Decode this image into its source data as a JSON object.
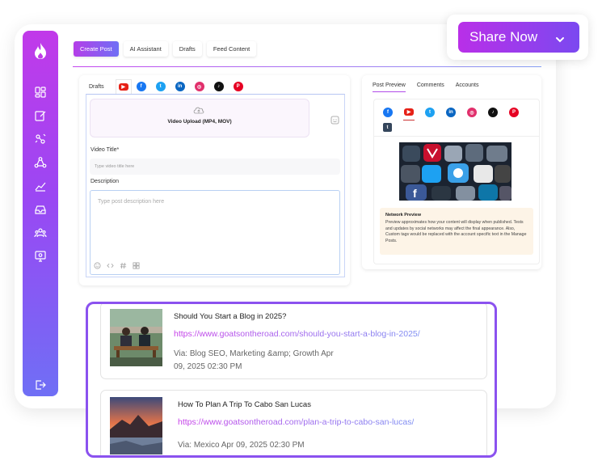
{
  "share": {
    "label": "Share Now"
  },
  "top_tabs": [
    "Create Post",
    "AI Assistant",
    "Drafts",
    "Feed Content"
  ],
  "editor": {
    "drafts_label": "Drafts",
    "networks": [
      {
        "name": "youtube",
        "color": "#e62117",
        "glyph": "▶"
      },
      {
        "name": "facebook",
        "color": "#1877f2",
        "glyph": "f"
      },
      {
        "name": "twitter",
        "color": "#1da1f2",
        "glyph": "t"
      },
      {
        "name": "linkedin",
        "color": "#0a66c2",
        "glyph": "in"
      },
      {
        "name": "instagram",
        "color": "#e1306c",
        "glyph": "◎"
      },
      {
        "name": "tiktok",
        "color": "#111111",
        "glyph": "♪"
      },
      {
        "name": "pinterest",
        "color": "#e60023",
        "glyph": "P"
      }
    ],
    "upload_label": "Video Upload (MP4, MOV)",
    "video_title_label": "Video Title*",
    "video_title_placeholder": "Type video title here",
    "description_label": "Description",
    "description_placeholder": "Type post description here"
  },
  "preview": {
    "tabs": [
      "Post Preview",
      "Comments",
      "Accounts"
    ],
    "note_title": "Network Preview",
    "note_body": "Preview approximates how your content will display when published. Tests and updates by social networks may affect the final appearance. Also, Custom tags would be replaced with the account specific text in the Manage Posts."
  },
  "feed": {
    "items": [
      {
        "title": "Should You Start a Blog in 2025?",
        "url": "https://www.goatsontheroad.com/should-you-start-a-blog-in-2025/",
        "meta_line1": "Via: Blog SEO, Marketing &amp; Growth    Apr",
        "meta_line2": "09, 2025 02:30 PM"
      },
      {
        "title": "How To Plan A Trip To Cabo San Lucas",
        "url": "https://www.goatsontheroad.com/plan-a-trip-to-cabo-san-lucas/",
        "meta_line1": "Via: Mexico    Apr 09, 2025 02:30 PM",
        "meta_line2": ""
      }
    ]
  },
  "colors": {
    "accent": "#9b47f3",
    "accent_pink": "#c13ae9",
    "accent_blue": "#6f6ff5"
  }
}
